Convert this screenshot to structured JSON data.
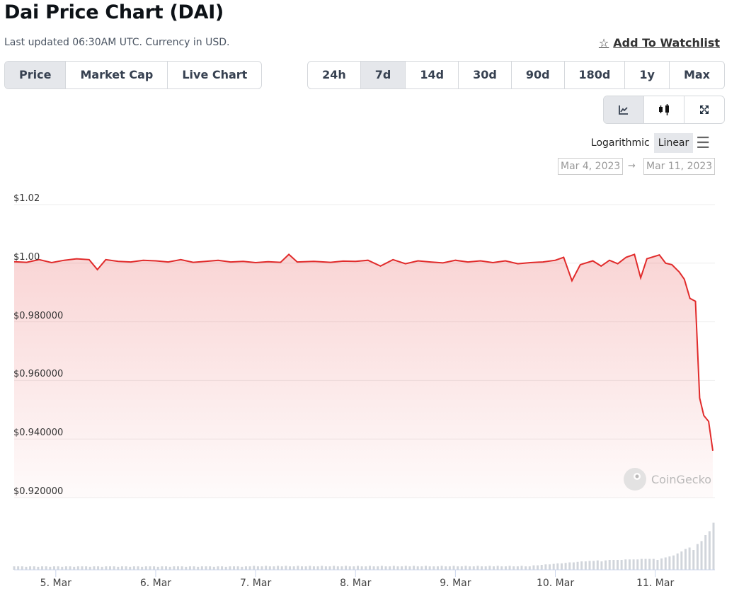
{
  "header": {
    "title": "Dai Price Chart (DAI)",
    "subtitle": "Last updated 06:30AM UTC. Currency in USD.",
    "watchlist": "Add To Watchlist"
  },
  "tabs": [
    {
      "label": "Price",
      "active": true
    },
    {
      "label": "Market Cap"
    },
    {
      "label": "Live Chart"
    }
  ],
  "ranges": [
    {
      "label": "24h"
    },
    {
      "label": "7d",
      "active": true
    },
    {
      "label": "14d"
    },
    {
      "label": "30d"
    },
    {
      "label": "90d"
    },
    {
      "label": "180d"
    },
    {
      "label": "1y"
    },
    {
      "label": "Max"
    }
  ],
  "chart_types": [
    {
      "icon": "line-chart-icon",
      "active": true
    },
    {
      "icon": "candlestick-icon"
    },
    {
      "icon": "fullscreen-icon"
    }
  ],
  "scale": {
    "log": "Logarithmic",
    "linear": "Linear",
    "active": "Linear"
  },
  "date_range": {
    "from": "Mar 4, 2023",
    "arrow": "→",
    "to": "Mar 11, 2023"
  },
  "watermark": "CoinGecko",
  "colors": {
    "line": "#e12b2b",
    "volume": "#d1d5db",
    "accent": "#e5e7eb"
  },
  "chart_data": {
    "type": "area",
    "ylim": [
      0.92,
      1.02
    ],
    "xlim": [
      "2023-03-04 14:00",
      "2023-03-11 14:00"
    ],
    "grid": true,
    "y_ticks": [
      {
        "v": 1.02,
        "label": "$1.02"
      },
      {
        "v": 1.0,
        "label": "$1.00"
      },
      {
        "v": 0.98,
        "label": "$0.980000"
      },
      {
        "v": 0.96,
        "label": "$0.960000"
      },
      {
        "v": 0.94,
        "label": "$0.940000"
      },
      {
        "v": 0.92,
        "label": "$0.920000"
      }
    ],
    "x_ticks": [
      {
        "t": "2023-03-05 00:00",
        "label": "5. Mar"
      },
      {
        "t": "2023-03-06 00:00",
        "label": "6. Mar"
      },
      {
        "t": "2023-03-07 00:00",
        "label": "7. Mar"
      },
      {
        "t": "2023-03-08 00:00",
        "label": "8. Mar"
      },
      {
        "t": "2023-03-09 00:00",
        "label": "9. Mar"
      },
      {
        "t": "2023-03-10 00:00",
        "label": "10. Mar"
      },
      {
        "t": "2023-03-11 00:00",
        "label": "11. Mar"
      }
    ],
    "price": [
      [
        "2023-03-04 14:00",
        1.0005
      ],
      [
        "2023-03-04 17:00",
        1.0003
      ],
      [
        "2023-03-04 20:00",
        1.0012
      ],
      [
        "2023-03-04 23:00",
        1.0002
      ],
      [
        "2023-03-05 02:00",
        1.001
      ],
      [
        "2023-03-05 05:00",
        1.0015
      ],
      [
        "2023-03-05 08:00",
        1.0012
      ],
      [
        "2023-03-05 10:00",
        0.9978
      ],
      [
        "2023-03-05 12:00",
        1.0012
      ],
      [
        "2023-03-05 15:00",
        1.0006
      ],
      [
        "2023-03-05 18:00",
        1.0004
      ],
      [
        "2023-03-05 21:00",
        1.001
      ],
      [
        "2023-03-06 00:00",
        1.0008
      ],
      [
        "2023-03-06 03:00",
        1.0004
      ],
      [
        "2023-03-06 06:00",
        1.0012
      ],
      [
        "2023-03-06 09:00",
        1.0003
      ],
      [
        "2023-03-06 12:00",
        1.0006
      ],
      [
        "2023-03-06 15:00",
        1.001
      ],
      [
        "2023-03-06 18:00",
        1.0004
      ],
      [
        "2023-03-06 21:00",
        1.0006
      ],
      [
        "2023-03-07 00:00",
        1.0002
      ],
      [
        "2023-03-07 03:00",
        1.0005
      ],
      [
        "2023-03-07 06:00",
        1.0003
      ],
      [
        "2023-03-07 08:00",
        1.003
      ],
      [
        "2023-03-07 10:00",
        1.0004
      ],
      [
        "2023-03-07 14:00",
        1.0006
      ],
      [
        "2023-03-07 18:00",
        1.0003
      ],
      [
        "2023-03-07 21:00",
        1.0007
      ],
      [
        "2023-03-08 00:00",
        1.0006
      ],
      [
        "2023-03-08 03:00",
        1.001
      ],
      [
        "2023-03-08 06:00",
        0.999
      ],
      [
        "2023-03-08 09:00",
        1.0012
      ],
      [
        "2023-03-08 12:00",
        0.9998
      ],
      [
        "2023-03-08 15:00",
        1.0008
      ],
      [
        "2023-03-08 18:00",
        1.0004
      ],
      [
        "2023-03-08 21:00",
        1.0001
      ],
      [
        "2023-03-09 00:00",
        1.001
      ],
      [
        "2023-03-09 03:00",
        1.0004
      ],
      [
        "2023-03-09 06:00",
        1.0008
      ],
      [
        "2023-03-09 09:00",
        1.0002
      ],
      [
        "2023-03-09 12:00",
        1.0008
      ],
      [
        "2023-03-09 15:00",
        0.9998
      ],
      [
        "2023-03-09 18:00",
        1.0002
      ],
      [
        "2023-03-09 21:00",
        1.0004
      ],
      [
        "2023-03-10 00:00",
        1.001
      ],
      [
        "2023-03-10 02:00",
        1.002
      ],
      [
        "2023-03-10 04:00",
        0.994
      ],
      [
        "2023-03-10 06:00",
        0.9995
      ],
      [
        "2023-03-10 09:00",
        1.0008
      ],
      [
        "2023-03-10 11:00",
        0.999
      ],
      [
        "2023-03-10 13:00",
        1.001
      ],
      [
        "2023-03-10 15:00",
        0.9998
      ],
      [
        "2023-03-10 17:00",
        1.002
      ],
      [
        "2023-03-10 19:00",
        1.003
      ],
      [
        "2023-03-10 20:30",
        0.995
      ],
      [
        "2023-03-10 22:00",
        1.0015
      ],
      [
        "2023-03-11 01:00",
        1.0028
      ],
      [
        "2023-03-11 02:30",
        1.0
      ],
      [
        "2023-03-11 04:00",
        0.9995
      ],
      [
        "2023-03-11 05:45",
        0.997
      ],
      [
        "2023-03-11 07:00",
        0.9945
      ],
      [
        "2023-03-11 08:20",
        0.988
      ],
      [
        "2023-03-11 09:40",
        0.987
      ],
      [
        "2023-03-11 10:40",
        0.954
      ],
      [
        "2023-03-11 11:40",
        0.948
      ],
      [
        "2023-03-11 12:50",
        0.946
      ],
      [
        "2023-03-11 13:50",
        0.936
      ]
    ],
    "volume_relative": [
      7,
      7,
      7,
      6,
      7,
      7,
      6,
      7,
      7,
      6,
      7,
      7,
      6,
      7,
      7,
      6,
      7,
      7,
      7,
      6,
      7,
      7,
      6,
      7,
      7,
      7,
      6,
      7,
      7,
      6,
      7,
      7,
      6,
      7,
      7,
      7,
      6,
      7,
      7,
      6,
      7,
      7,
      7,
      6,
      7,
      7,
      6,
      7,
      7,
      7,
      6,
      7,
      7,
      6,
      7,
      7,
      7,
      6,
      7,
      7,
      8,
      7,
      7,
      8,
      7,
      7,
      8,
      7,
      8,
      7,
      7,
      8,
      7,
      7,
      8,
      7,
      7,
      8,
      7,
      7,
      8,
      7,
      7,
      8,
      7,
      7,
      8,
      7,
      7,
      8,
      7,
      7,
      8,
      7,
      7,
      8,
      7,
      7,
      8,
      7,
      8,
      7,
      7,
      8,
      7,
      7,
      7,
      8,
      7,
      7,
      8,
      7,
      7,
      8,
      7,
      7,
      8,
      7,
      7,
      8,
      7,
      8,
      7,
      7,
      8,
      7,
      7,
      8,
      7,
      7,
      9,
      9,
      10,
      11,
      11,
      12,
      13,
      13,
      14,
      15,
      15,
      16,
      17,
      17,
      18,
      18,
      19,
      17,
      19,
      20,
      20,
      20,
      20,
      21,
      21,
      21,
      21,
      22,
      22,
      22,
      22,
      20,
      23,
      25,
      27,
      29,
      33,
      37,
      42,
      45,
      40,
      52,
      58,
      70,
      78,
      95
    ]
  }
}
